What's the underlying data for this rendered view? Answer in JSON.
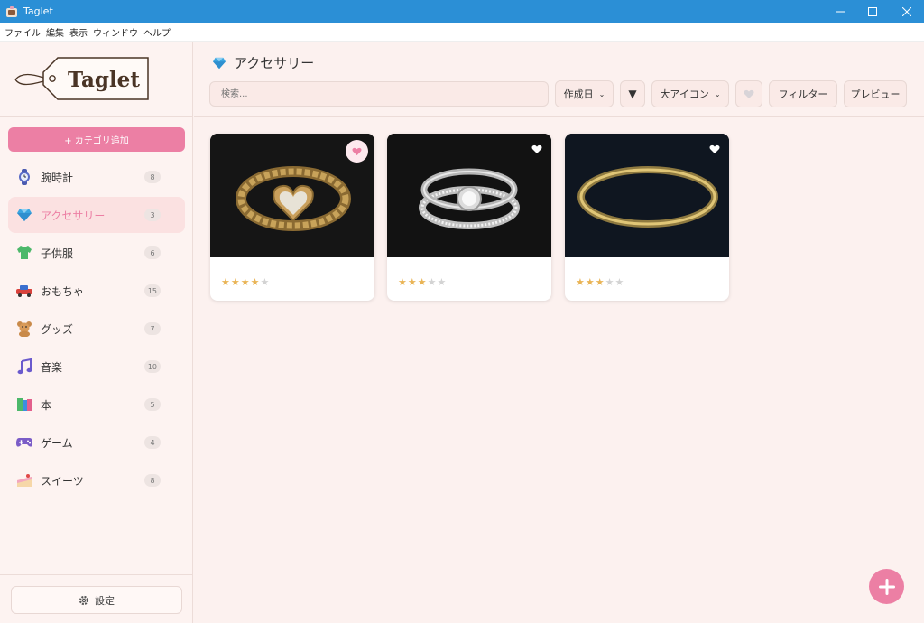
{
  "window": {
    "title": "Taglet"
  },
  "menu": [
    "ファイル",
    "編集",
    "表示",
    "ウィンドウ",
    "ヘルプ"
  ],
  "logo": {
    "text": "Taglet"
  },
  "sidebar": {
    "add_category_label": "+ カテゴリ追加",
    "categories": [
      {
        "label": "腕時計",
        "count": "8",
        "icon": "watch-icon",
        "active": false
      },
      {
        "label": "アクセサリー",
        "count": "3",
        "icon": "gem-icon",
        "active": true
      },
      {
        "label": "子供服",
        "count": "6",
        "icon": "tshirt-icon",
        "active": false
      },
      {
        "label": "おもちゃ",
        "count": "15",
        "icon": "toy-car-icon",
        "active": false
      },
      {
        "label": "グッズ",
        "count": "7",
        "icon": "teddy-bear-icon",
        "active": false
      },
      {
        "label": "音楽",
        "count": "10",
        "icon": "music-note-icon",
        "active": false
      },
      {
        "label": "本",
        "count": "5",
        "icon": "books-icon",
        "active": false
      },
      {
        "label": "ゲーム",
        "count": "4",
        "icon": "gamepad-icon",
        "active": false
      },
      {
        "label": "スイーツ",
        "count": "8",
        "icon": "cake-icon",
        "active": false
      }
    ],
    "settings_label": "設定"
  },
  "header": {
    "title": "アクセサリー",
    "search_placeholder": "検索...",
    "sort_value": "作成日",
    "sort_order_symbol": "▼",
    "view_value": "大アイコン",
    "filter_label": "フィルター",
    "preview_label": "プレビュー"
  },
  "items": [
    {
      "image": "gold-heart-ring",
      "rating": 4,
      "favorite": true
    },
    {
      "image": "silver-diamond-ring-set",
      "rating": 3,
      "favorite": false
    },
    {
      "image": "gold-band-ring",
      "rating": 3,
      "favorite": false
    }
  ],
  "colors": {
    "accent": "#ec7fa4",
    "titlebar": "#2b8fd6",
    "background": "#fcf1ef",
    "star": "#e9b455"
  }
}
